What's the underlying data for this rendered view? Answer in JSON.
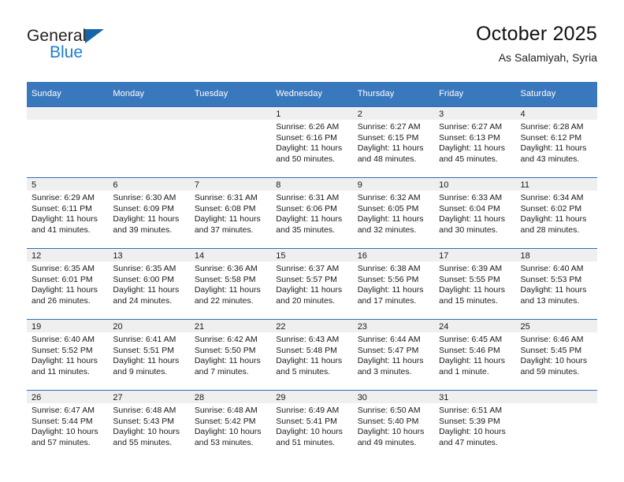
{
  "brand": {
    "name_part1": "General",
    "name_part2": "Blue",
    "accent_color": "#1b7fd4",
    "triangle_color": "#1565a8"
  },
  "header": {
    "title": "October 2025",
    "subtitle": "As Salamiyah, Syria"
  },
  "calendar": {
    "header_bg": "#3a78bd",
    "daynum_bg": "#efefef",
    "weekday_headers": [
      "Sunday",
      "Monday",
      "Tuesday",
      "Wednesday",
      "Thursday",
      "Friday",
      "Saturday"
    ],
    "weeks": [
      [
        {
          "day": "",
          "sunrise": "",
          "sunset": "",
          "daylight1": "",
          "daylight2": ""
        },
        {
          "day": "",
          "sunrise": "",
          "sunset": "",
          "daylight1": "",
          "daylight2": ""
        },
        {
          "day": "",
          "sunrise": "",
          "sunset": "",
          "daylight1": "",
          "daylight2": ""
        },
        {
          "day": "1",
          "sunrise": "Sunrise: 6:26 AM",
          "sunset": "Sunset: 6:16 PM",
          "daylight1": "Daylight: 11 hours",
          "daylight2": "and 50 minutes."
        },
        {
          "day": "2",
          "sunrise": "Sunrise: 6:27 AM",
          "sunset": "Sunset: 6:15 PM",
          "daylight1": "Daylight: 11 hours",
          "daylight2": "and 48 minutes."
        },
        {
          "day": "3",
          "sunrise": "Sunrise: 6:27 AM",
          "sunset": "Sunset: 6:13 PM",
          "daylight1": "Daylight: 11 hours",
          "daylight2": "and 45 minutes."
        },
        {
          "day": "4",
          "sunrise": "Sunrise: 6:28 AM",
          "sunset": "Sunset: 6:12 PM",
          "daylight1": "Daylight: 11 hours",
          "daylight2": "and 43 minutes."
        }
      ],
      [
        {
          "day": "5",
          "sunrise": "Sunrise: 6:29 AM",
          "sunset": "Sunset: 6:11 PM",
          "daylight1": "Daylight: 11 hours",
          "daylight2": "and 41 minutes."
        },
        {
          "day": "6",
          "sunrise": "Sunrise: 6:30 AM",
          "sunset": "Sunset: 6:09 PM",
          "daylight1": "Daylight: 11 hours",
          "daylight2": "and 39 minutes."
        },
        {
          "day": "7",
          "sunrise": "Sunrise: 6:31 AM",
          "sunset": "Sunset: 6:08 PM",
          "daylight1": "Daylight: 11 hours",
          "daylight2": "and 37 minutes."
        },
        {
          "day": "8",
          "sunrise": "Sunrise: 6:31 AM",
          "sunset": "Sunset: 6:06 PM",
          "daylight1": "Daylight: 11 hours",
          "daylight2": "and 35 minutes."
        },
        {
          "day": "9",
          "sunrise": "Sunrise: 6:32 AM",
          "sunset": "Sunset: 6:05 PM",
          "daylight1": "Daylight: 11 hours",
          "daylight2": "and 32 minutes."
        },
        {
          "day": "10",
          "sunrise": "Sunrise: 6:33 AM",
          "sunset": "Sunset: 6:04 PM",
          "daylight1": "Daylight: 11 hours",
          "daylight2": "and 30 minutes."
        },
        {
          "day": "11",
          "sunrise": "Sunrise: 6:34 AM",
          "sunset": "Sunset: 6:02 PM",
          "daylight1": "Daylight: 11 hours",
          "daylight2": "and 28 minutes."
        }
      ],
      [
        {
          "day": "12",
          "sunrise": "Sunrise: 6:35 AM",
          "sunset": "Sunset: 6:01 PM",
          "daylight1": "Daylight: 11 hours",
          "daylight2": "and 26 minutes."
        },
        {
          "day": "13",
          "sunrise": "Sunrise: 6:35 AM",
          "sunset": "Sunset: 6:00 PM",
          "daylight1": "Daylight: 11 hours",
          "daylight2": "and 24 minutes."
        },
        {
          "day": "14",
          "sunrise": "Sunrise: 6:36 AM",
          "sunset": "Sunset: 5:58 PM",
          "daylight1": "Daylight: 11 hours",
          "daylight2": "and 22 minutes."
        },
        {
          "day": "15",
          "sunrise": "Sunrise: 6:37 AM",
          "sunset": "Sunset: 5:57 PM",
          "daylight1": "Daylight: 11 hours",
          "daylight2": "and 20 minutes."
        },
        {
          "day": "16",
          "sunrise": "Sunrise: 6:38 AM",
          "sunset": "Sunset: 5:56 PM",
          "daylight1": "Daylight: 11 hours",
          "daylight2": "and 17 minutes."
        },
        {
          "day": "17",
          "sunrise": "Sunrise: 6:39 AM",
          "sunset": "Sunset: 5:55 PM",
          "daylight1": "Daylight: 11 hours",
          "daylight2": "and 15 minutes."
        },
        {
          "day": "18",
          "sunrise": "Sunrise: 6:40 AM",
          "sunset": "Sunset: 5:53 PM",
          "daylight1": "Daylight: 11 hours",
          "daylight2": "and 13 minutes."
        }
      ],
      [
        {
          "day": "19",
          "sunrise": "Sunrise: 6:40 AM",
          "sunset": "Sunset: 5:52 PM",
          "daylight1": "Daylight: 11 hours",
          "daylight2": "and 11 minutes."
        },
        {
          "day": "20",
          "sunrise": "Sunrise: 6:41 AM",
          "sunset": "Sunset: 5:51 PM",
          "daylight1": "Daylight: 11 hours",
          "daylight2": "and 9 minutes."
        },
        {
          "day": "21",
          "sunrise": "Sunrise: 6:42 AM",
          "sunset": "Sunset: 5:50 PM",
          "daylight1": "Daylight: 11 hours",
          "daylight2": "and 7 minutes."
        },
        {
          "day": "22",
          "sunrise": "Sunrise: 6:43 AM",
          "sunset": "Sunset: 5:48 PM",
          "daylight1": "Daylight: 11 hours",
          "daylight2": "and 5 minutes."
        },
        {
          "day": "23",
          "sunrise": "Sunrise: 6:44 AM",
          "sunset": "Sunset: 5:47 PM",
          "daylight1": "Daylight: 11 hours",
          "daylight2": "and 3 minutes."
        },
        {
          "day": "24",
          "sunrise": "Sunrise: 6:45 AM",
          "sunset": "Sunset: 5:46 PM",
          "daylight1": "Daylight: 11 hours",
          "daylight2": "and 1 minute."
        },
        {
          "day": "25",
          "sunrise": "Sunrise: 6:46 AM",
          "sunset": "Sunset: 5:45 PM",
          "daylight1": "Daylight: 10 hours",
          "daylight2": "and 59 minutes."
        }
      ],
      [
        {
          "day": "26",
          "sunrise": "Sunrise: 6:47 AM",
          "sunset": "Sunset: 5:44 PM",
          "daylight1": "Daylight: 10 hours",
          "daylight2": "and 57 minutes."
        },
        {
          "day": "27",
          "sunrise": "Sunrise: 6:48 AM",
          "sunset": "Sunset: 5:43 PM",
          "daylight1": "Daylight: 10 hours",
          "daylight2": "and 55 minutes."
        },
        {
          "day": "28",
          "sunrise": "Sunrise: 6:48 AM",
          "sunset": "Sunset: 5:42 PM",
          "daylight1": "Daylight: 10 hours",
          "daylight2": "and 53 minutes."
        },
        {
          "day": "29",
          "sunrise": "Sunrise: 6:49 AM",
          "sunset": "Sunset: 5:41 PM",
          "daylight1": "Daylight: 10 hours",
          "daylight2": "and 51 minutes."
        },
        {
          "day": "30",
          "sunrise": "Sunrise: 6:50 AM",
          "sunset": "Sunset: 5:40 PM",
          "daylight1": "Daylight: 10 hours",
          "daylight2": "and 49 minutes."
        },
        {
          "day": "31",
          "sunrise": "Sunrise: 6:51 AM",
          "sunset": "Sunset: 5:39 PM",
          "daylight1": "Daylight: 10 hours",
          "daylight2": "and 47 minutes."
        },
        {
          "day": "",
          "sunrise": "",
          "sunset": "",
          "daylight1": "",
          "daylight2": ""
        }
      ]
    ]
  }
}
